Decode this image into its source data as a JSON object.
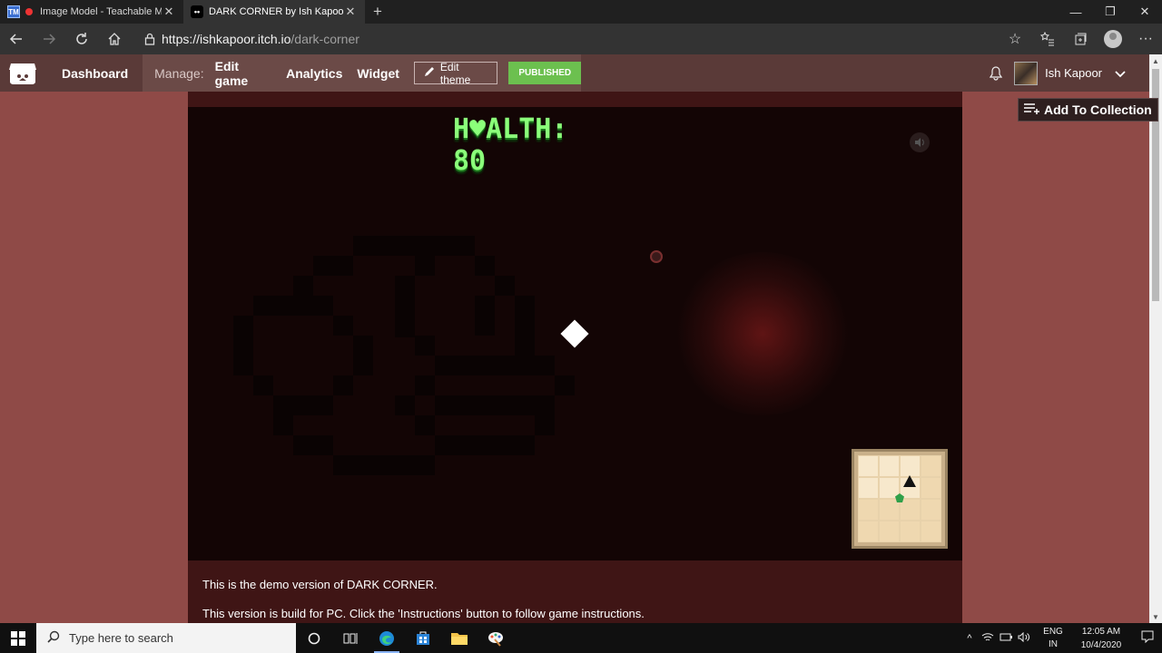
{
  "browser": {
    "tabs": [
      {
        "title": "Image Model - Teachable M",
        "favicon": "TM"
      },
      {
        "title": "DARK CORNER by Ish Kapoor",
        "favicon": "••"
      }
    ],
    "url": {
      "host": "https://ishkapoor.itch.io",
      "path": "/dark-corner"
    }
  },
  "itch": {
    "dashboard": "Dashboard",
    "manage_label": "Manage:",
    "links": [
      "Edit game",
      "Analytics",
      "Widget"
    ],
    "edit_theme": "Edit theme",
    "published": "PUBLISHED",
    "user_name": "Ish Kapoor"
  },
  "game": {
    "health_text": "H♥ALTH: 80"
  },
  "page": {
    "add_to_collection": "Add To Collection",
    "description": [
      "This is the demo version of DARK CORNER.",
      "This version is build for PC.  Click the 'Instructions' button to follow game instructions."
    ]
  },
  "taskbar": {
    "search_placeholder": "Type here to search",
    "lang_top": "ENG",
    "lang_bottom": "IN",
    "time": "12:05 AM",
    "date": "10/4/2020"
  }
}
